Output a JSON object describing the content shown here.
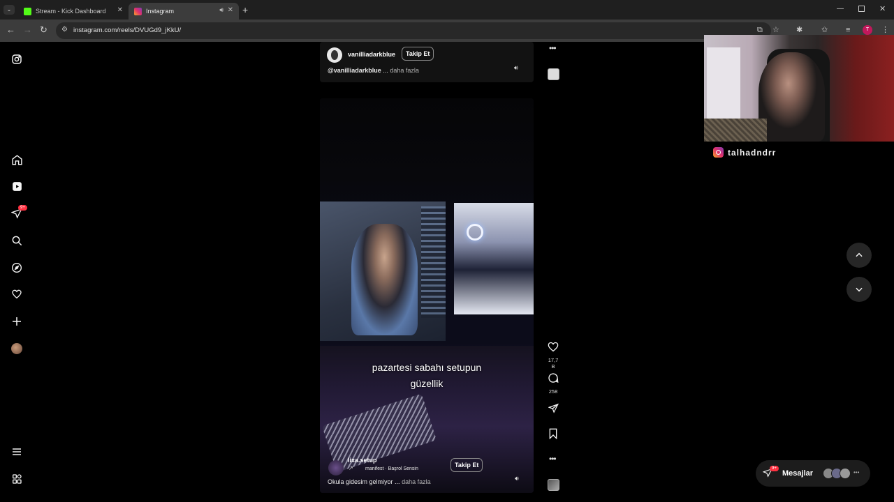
{
  "browser": {
    "tabs": [
      {
        "title": "Stream - Kick Dashboard",
        "icon": "kick-icon"
      },
      {
        "title": "Instagram",
        "icon": "instagram-icon"
      }
    ],
    "url": "instagram.com/reels/DVUGd9_jKkU/"
  },
  "reel_top": {
    "username": "vanilliadarkblue",
    "follow_label": "Takip Et",
    "caption_user": "@vanilliadarkblue",
    "caption_sep": " ...",
    "more_label": "daha fazla"
  },
  "reel_main": {
    "overlay_text_line1": "pazartesi sabahı setupun",
    "overlay_text_line2": "güzellik",
    "username": "lixa.setup",
    "audio": "manifest · Başrol Sensin",
    "follow_label": "Takip Et",
    "caption": "Okula gidesim gelmiyor ...",
    "more_label": "daha fazla",
    "likes": "17,7 B",
    "comments": "258"
  },
  "sidebar": {
    "notification_badge": "9+"
  },
  "overlay": {
    "streamer_handle": "talhadndrr"
  },
  "messages": {
    "label": "Mesajlar",
    "badge": "9+"
  },
  "colors": {
    "accent_red": "#ff3040",
    "background": "#000000",
    "card": "#0b0b0b"
  }
}
